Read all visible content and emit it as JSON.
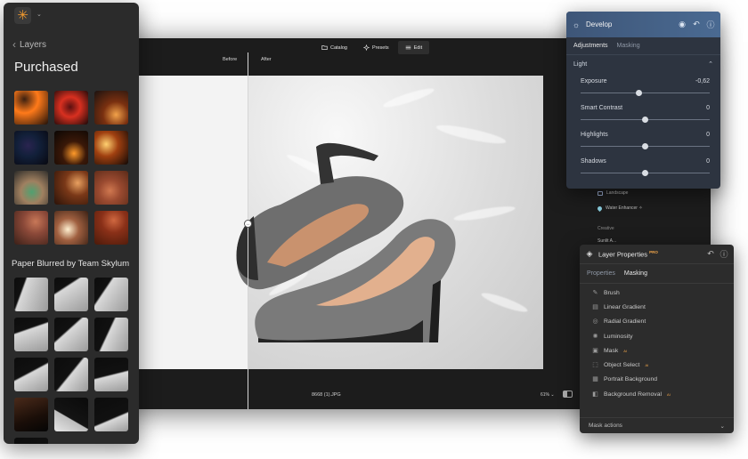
{
  "editor": {
    "nav": [
      {
        "label": "Catalog",
        "icon": "folder-icon"
      },
      {
        "label": "Presets",
        "icon": "presets-icon"
      },
      {
        "label": "Edit",
        "icon": "sliders-icon"
      }
    ],
    "before_label": "Before",
    "after_label": "After",
    "filename": "8668 (1).JPG",
    "zoom": "61% ⌄",
    "behind_items": [
      "Landscape",
      "Water Enhancer ✧",
      "Creative",
      "Sunlit A..."
    ]
  },
  "layers": {
    "back_label": "Layers",
    "section1_title": "Purchased",
    "section2_title": "Paper Blurred by Team Skylum",
    "purchased_colors": [
      "#3b2010,#ff7a1a,#201008",
      "#5a1010,#d83020,#1a0808",
      "#f2a24a,#7a3010,#1a1210",
      "#2a2450,#12203a,#080810",
      "#ff9a2a,#3a1808,#0a0604",
      "#ffd070,#a04010,#100806",
      "#50a070,#a08060,#2a2a28",
      "#e8a060,#7a3818,#2a1208",
      "#d07850,#9a4a30,#5a2a18",
      "#c87858,#8a4838,#3a2018",
      "#fff0d0,#a06040,#3a2014",
      "#d06840,#8a3018,#4a1a0a"
    ],
    "paper_count": 13
  },
  "develop": {
    "title": "Develop",
    "tabs": [
      "Adjustments",
      "Masking"
    ],
    "section": "Light",
    "sliders": [
      {
        "label": "Exposure",
        "value": "-0,62",
        "pos": 0.45
      },
      {
        "label": "Smart Contrast",
        "value": "0",
        "pos": 0.5
      },
      {
        "label": "Highlights",
        "value": "0",
        "pos": 0.5
      },
      {
        "label": "Shadows",
        "value": "0",
        "pos": 0.5
      }
    ]
  },
  "layer_properties": {
    "title": "Layer Properties",
    "pro_badge": "PRO",
    "tabs": [
      "Properties",
      "Masking"
    ],
    "items": [
      {
        "label": "Brush",
        "icon": "brush-icon",
        "ai": ""
      },
      {
        "label": "Linear Gradient",
        "icon": "linear-gradient-icon",
        "ai": ""
      },
      {
        "label": "Radial Gradient",
        "icon": "radial-gradient-icon",
        "ai": ""
      },
      {
        "label": "Luminosity",
        "icon": "luminosity-icon",
        "ai": ""
      },
      {
        "label": "Mask",
        "icon": "mask-icon",
        "ai": "AI"
      },
      {
        "label": "Object Select",
        "icon": "object-select-icon",
        "ai": "AI"
      },
      {
        "label": "Portrait Background",
        "icon": "portrait-icon",
        "ai": ""
      },
      {
        "label": "Background Removal",
        "icon": "background-removal-icon",
        "ai": "AI"
      }
    ],
    "mask_actions": "Mask actions"
  }
}
